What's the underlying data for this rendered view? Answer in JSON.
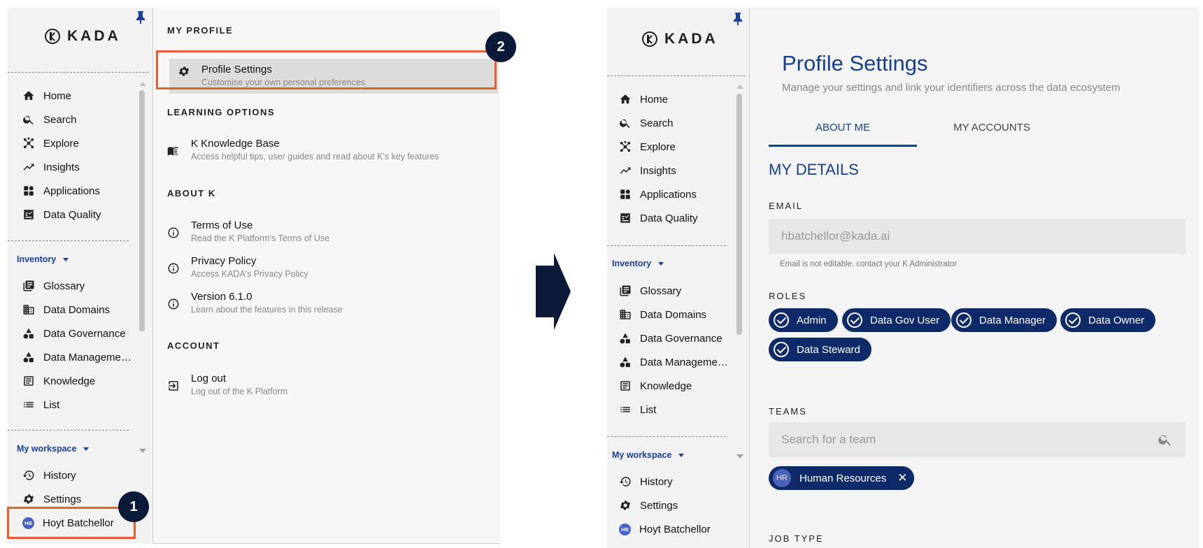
{
  "brand": {
    "name": "KADA"
  },
  "sidebar": {
    "main_items": [
      {
        "label": "Home",
        "icon": "home-icon"
      },
      {
        "label": "Search",
        "icon": "search-icon"
      },
      {
        "label": "Explore",
        "icon": "explore-icon"
      },
      {
        "label": "Insights",
        "icon": "insights-icon"
      },
      {
        "label": "Applications",
        "icon": "applications-icon"
      },
      {
        "label": "Data Quality",
        "icon": "data-quality-icon"
      }
    ],
    "inventory_label": "Inventory",
    "inventory_items": [
      {
        "label": "Glossary",
        "icon": "glossary-icon"
      },
      {
        "label": "Data Domains",
        "icon": "data-domains-icon"
      },
      {
        "label": "Data Governance",
        "icon": "data-governance-icon"
      },
      {
        "label": "Data Manageme…",
        "icon": "data-management-icon"
      },
      {
        "label": "Knowledge",
        "icon": "knowledge-icon"
      },
      {
        "label": "List",
        "icon": "list-icon"
      }
    ],
    "workspace_label": "My workspace",
    "workspace_items": [
      {
        "label": "History",
        "icon": "history-icon"
      },
      {
        "label": "Settings",
        "icon": "gear-icon"
      }
    ],
    "user": {
      "initials": "HB",
      "name": "Hoyt Batchellor"
    }
  },
  "profile_menu": {
    "sections": [
      {
        "heading": "MY PROFILE",
        "items": [
          {
            "title": "Profile Settings",
            "subtitle": "Customise your own personal preferences",
            "icon": "gear-icon"
          }
        ]
      },
      {
        "heading": "LEARNING OPTIONS",
        "items": [
          {
            "title": "K Knowledge Base",
            "subtitle": "Access helpful tips, user guides and read about K's key features",
            "icon": "book-icon"
          }
        ]
      },
      {
        "heading": "ABOUT K",
        "items": [
          {
            "title": "Terms of Use",
            "subtitle": "Read the K Platform's Terms of Use",
            "icon": "info-icon"
          },
          {
            "title": "Privacy Policy",
            "subtitle": "Access KADA's Privacy Policy",
            "icon": "info-icon"
          },
          {
            "title": "Version 6.1.0",
            "subtitle": "Learn about the features in this release",
            "icon": "info-icon"
          }
        ]
      },
      {
        "heading": "ACCOUNT",
        "items": [
          {
            "title": "Log out",
            "subtitle": "Log out of the K Platform",
            "icon": "logout-icon"
          }
        ]
      }
    ]
  },
  "steps": {
    "one": "1",
    "two": "2"
  },
  "profile_settings": {
    "title": "Profile Settings",
    "subtitle": "Manage your settings and link your identifiers across the data ecosystem",
    "tabs": [
      "ABOUT ME",
      "MY ACCOUNTS"
    ],
    "section_title": "MY DETAILS",
    "email_label": "EMAIL",
    "email_value": "hbatchellor@kada.ai",
    "email_help": "Email is not editable. contact your K Administrator",
    "roles_label": "ROLES",
    "roles": [
      "Admin",
      "Data Gov User",
      "Data Manager",
      "Data Owner",
      "Data Steward"
    ],
    "teams_label": "TEAMS",
    "teams_placeholder": "Search for a team",
    "team_chip": {
      "initials": "HR",
      "name": "Human Resources"
    },
    "job_type_label": "JOB TYPE"
  },
  "colors": {
    "accent": "#15408f",
    "highlight": "#e85e2c",
    "chip": "#0f2a68",
    "badge": "#0c1a3a"
  }
}
